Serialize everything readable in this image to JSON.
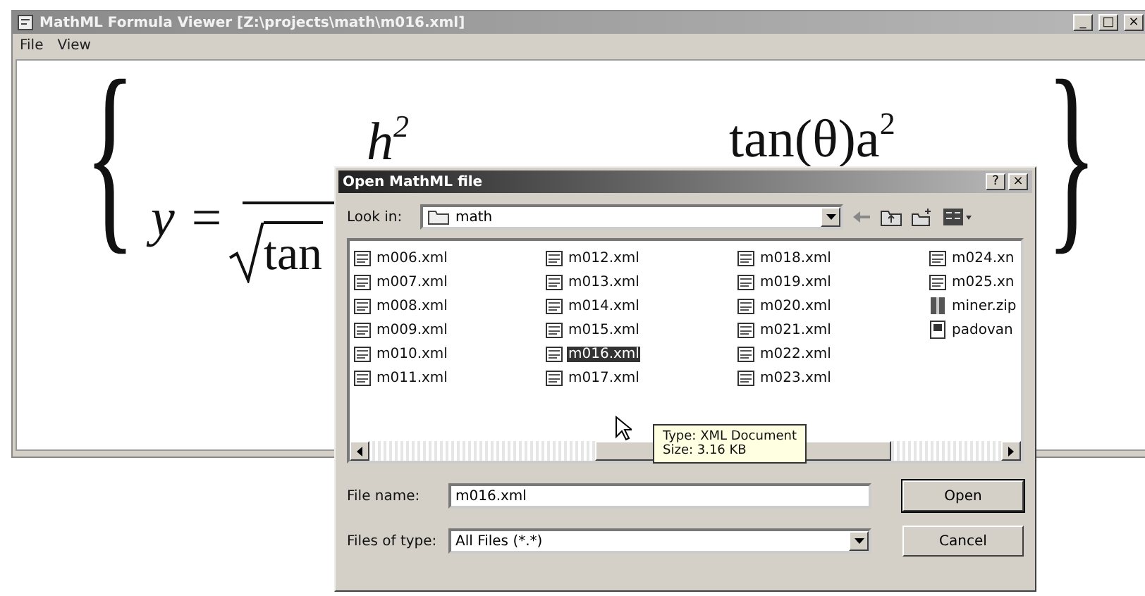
{
  "window": {
    "title": "MathML Formula Viewer [Z:\\projects\\math\\m016.xml]",
    "controls": [
      "_",
      "□",
      "×"
    ]
  },
  "menu": [
    "File",
    "View"
  ],
  "formula": {
    "open_brace": "{",
    "lhs": "y =",
    "numerator": "h$^{2}$",
    "denominator": "tan",
    "right_numerator": "tan(θ)a$^{2}$",
    "close_brace": "}"
  },
  "dialog": {
    "title": "Open MathML file",
    "title_buttons": [
      "?",
      "×"
    ],
    "look_in": {
      "label": "Look in:",
      "value": "math"
    },
    "files": [
      [
        {
          "name": "m006.xml",
          "kind": "xml",
          "selected": false
        },
        {
          "name": "m007.xml",
          "kind": "xml",
          "selected": false
        },
        {
          "name": "m008.xml",
          "kind": "xml",
          "selected": false
        },
        {
          "name": "m009.xml",
          "kind": "xml",
          "selected": false
        },
        {
          "name": "m010.xml",
          "kind": "xml",
          "selected": false
        },
        {
          "name": "m011.xml",
          "kind": "xml",
          "selected": false
        }
      ],
      [
        {
          "name": "m012.xml",
          "kind": "xml",
          "selected": false
        },
        {
          "name": "m013.xml",
          "kind": "xml",
          "selected": false
        },
        {
          "name": "m014.xml",
          "kind": "xml",
          "selected": false
        },
        {
          "name": "m015.xml",
          "kind": "xml",
          "selected": false
        },
        {
          "name": "m016.xml",
          "kind": "xml",
          "selected": true
        },
        {
          "name": "m017.xml",
          "kind": "xml",
          "selected": false
        }
      ],
      [
        {
          "name": "m018.xml",
          "kind": "xml",
          "selected": false
        },
        {
          "name": "m019.xml",
          "kind": "xml",
          "selected": false
        },
        {
          "name": "m020.xml",
          "kind": "xml",
          "selected": false
        },
        {
          "name": "m021.xml",
          "kind": "xml",
          "selected": false
        },
        {
          "name": "m022.xml",
          "kind": "xml",
          "selected": false
        },
        {
          "name": "m023.xml",
          "kind": "xml",
          "selected": false
        }
      ],
      [
        {
          "name": "m024.xn",
          "kind": "xml",
          "selected": false
        },
        {
          "name": "m025.xn",
          "kind": "xml",
          "selected": false
        },
        {
          "name": "miner.zip",
          "kind": "zip",
          "selected": false
        },
        {
          "name": "padovan",
          "kind": "doc",
          "selected": false
        }
      ]
    ],
    "tooltip": [
      "Type: XML Document",
      "Size: 3.16 KB"
    ],
    "file_name": {
      "label": "File name:",
      "value": "m016.xml"
    },
    "file_type": {
      "label": "Files of type:",
      "value": "All Files (*.*)"
    },
    "buttons": [
      "Open",
      "Cancel"
    ]
  }
}
